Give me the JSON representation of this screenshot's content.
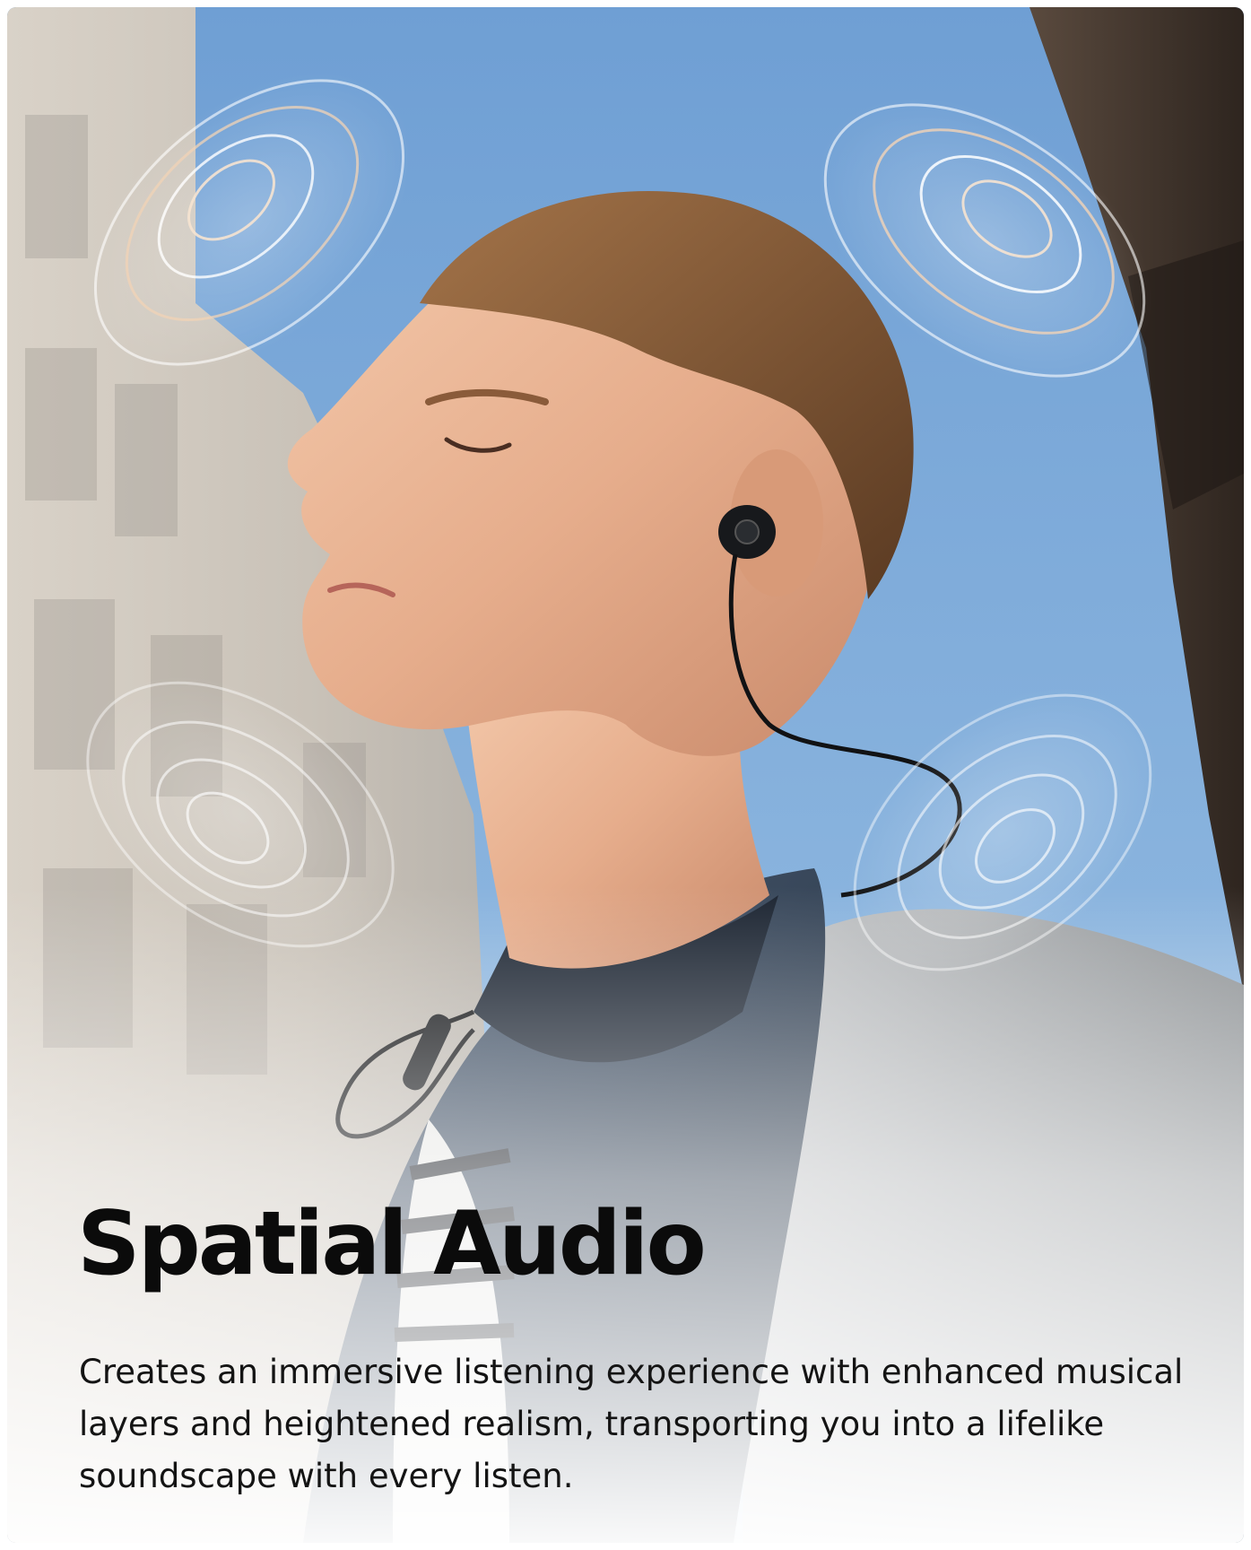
{
  "feature": {
    "title": "Spatial Audio",
    "description": "Creates an immersive listening experience with enhanced musical layers and heightened realism, transporting you into a lifelike soundscape with every listen."
  },
  "image": {
    "subject": "young man with closed eyes wearing black neckband earphones",
    "sound_wave_icons": 4
  },
  "colors": {
    "sky": "#7fa9d8",
    "jacket": "#3a4a5e",
    "text": "#0b0b0b",
    "wave": "#ffffff",
    "wave_warm": "#f2d3b6"
  }
}
